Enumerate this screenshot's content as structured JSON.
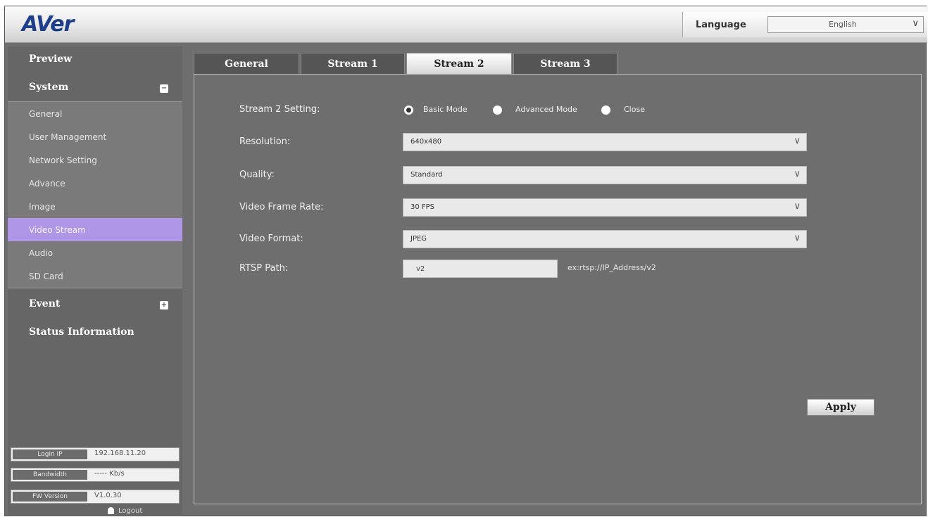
{
  "header": {
    "logo": "AVer",
    "language_label": "Language",
    "language_value": "English"
  },
  "sidebar": {
    "preview": "Preview",
    "system": "System",
    "system_toggle": "−",
    "items": [
      "General",
      "User Management",
      "Network Setting",
      "Advance",
      "Image",
      "Video Stream",
      "Audio",
      "SD Card"
    ],
    "active_item": "Video Stream",
    "event": "Event",
    "event_toggle": "+",
    "status_information": "Status Information",
    "info": {
      "login_ip_label": "Login IP",
      "login_ip_value": "192.168.11.20",
      "bandwidth_label": "Bandwidth",
      "bandwidth_value": "----- Kb/s",
      "fw_version_label": "FW Version",
      "fw_version_value": "V1.0.30"
    },
    "logout": "Logout"
  },
  "tabs": [
    "General",
    "Stream 1",
    "Stream 2",
    "Stream 3"
  ],
  "active_tab": "Stream 2",
  "form": {
    "setting_label": "Stream 2 Setting:",
    "modes": [
      "Basic Mode",
      "Advanced Mode",
      "Close"
    ],
    "selected_mode": "Basic Mode",
    "resolution_label": "Resolution:",
    "resolution_value": "640x480",
    "quality_label": "Quality:",
    "quality_value": "Standard",
    "frame_rate_label": "Video Frame Rate:",
    "frame_rate_value": "30 FPS",
    "format_label": "Video Format:",
    "format_value": "JPEG",
    "rtsp_label": "RTSP Path:",
    "rtsp_value": "v2",
    "rtsp_hint": "ex:rtsp://IP_Address/v2",
    "apply_label": "Apply"
  },
  "colors": {
    "accent_active": "#b096e6",
    "logo_blue": "#1d3f8a",
    "content_bg": "#6e6e6e"
  }
}
